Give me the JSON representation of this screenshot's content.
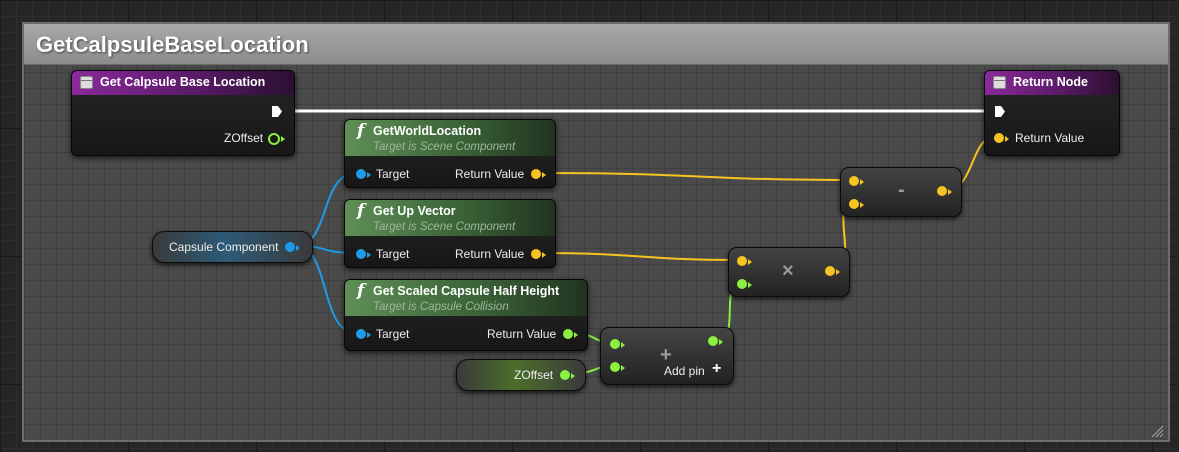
{
  "comment": {
    "title": "GetCalpsuleBaseLocation"
  },
  "entry_node": {
    "title": "Get Calpsule Base Location",
    "output_pin": "ZOffset"
  },
  "return_node": {
    "title": "Return Node",
    "input_pin": "Return Value"
  },
  "get_world_location": {
    "title": "GetWorldLocation",
    "subtitle": "Target is Scene Component",
    "input_pin": "Target",
    "output_pin": "Return Value"
  },
  "get_up_vector": {
    "title": "Get Up Vector",
    "subtitle": "Target is Scene Component",
    "input_pin": "Target",
    "output_pin": "Return Value"
  },
  "get_half_height": {
    "title": "Get Scaled Capsule Half Height",
    "subtitle": "Target is Capsule Collision",
    "input_pin": "Target",
    "output_pin": "Return Value"
  },
  "capsule_var": {
    "label": "Capsule Component"
  },
  "zoffset_var": {
    "label": "ZOffset"
  },
  "subtract_node": {
    "symbol": "-"
  },
  "multiply_node": {
    "symbol": "×"
  },
  "add_node": {
    "symbol": "+",
    "add_pin_label": "Add pin"
  },
  "colors": {
    "exec_wire": "#ffffff",
    "object_pin": "#1d9be8",
    "vector_pin": "#f6c320",
    "float_pin": "#8cf040",
    "function_header": "#3a6337",
    "event_header": "#8a2a9a"
  }
}
